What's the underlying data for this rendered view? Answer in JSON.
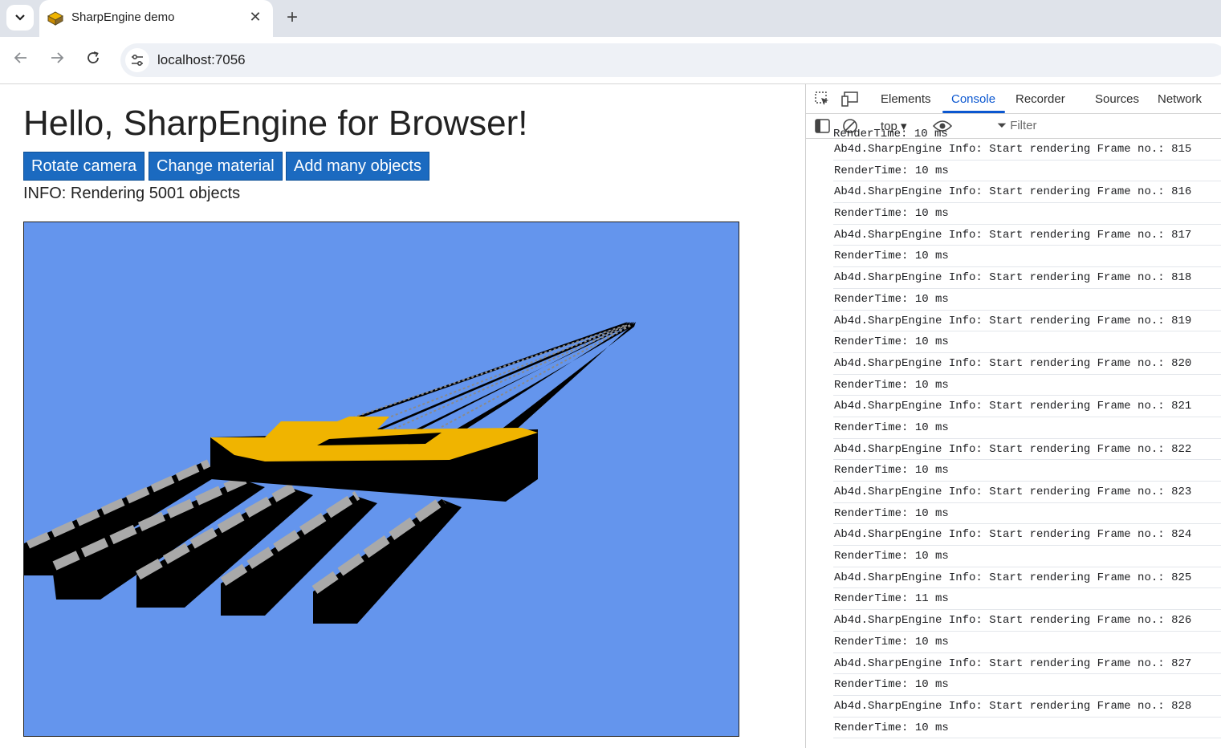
{
  "browser": {
    "tab_title": "SharpEngine demo",
    "url": "localhost:7056"
  },
  "page": {
    "heading": "Hello, SharpEngine for Browser!",
    "buttons": [
      "Rotate camera",
      "Change material",
      "Add many objects"
    ],
    "info": "INFO: Rendering 5001 objects",
    "colors": {
      "scene_background": "#6495ed",
      "button": "#1b6ac0",
      "highlight_objects": "#f0b400",
      "box_top": "#a9a9a9"
    }
  },
  "devtools": {
    "tabs": [
      "Elements",
      "Console",
      "Recorder",
      "Sources",
      "Network"
    ],
    "active_tab": "Console",
    "context": "top",
    "filter_placeholder": "Filter",
    "partial_line": "RenderTime: 10 ms",
    "log": [
      "Ab4d.SharpEngine Info: Start rendering Frame no.: 815",
      "RenderTime: 10 ms",
      "Ab4d.SharpEngine Info: Start rendering Frame no.: 816",
      "RenderTime: 10 ms",
      "Ab4d.SharpEngine Info: Start rendering Frame no.: 817",
      "RenderTime: 10 ms",
      "Ab4d.SharpEngine Info: Start rendering Frame no.: 818",
      "RenderTime: 10 ms",
      "Ab4d.SharpEngine Info: Start rendering Frame no.: 819",
      "RenderTime: 10 ms",
      "Ab4d.SharpEngine Info: Start rendering Frame no.: 820",
      "RenderTime: 10 ms",
      "Ab4d.SharpEngine Info: Start rendering Frame no.: 821",
      "RenderTime: 10 ms",
      "Ab4d.SharpEngine Info: Start rendering Frame no.: 822",
      "RenderTime: 10 ms",
      "Ab4d.SharpEngine Info: Start rendering Frame no.: 823",
      "RenderTime: 10 ms",
      "Ab4d.SharpEngine Info: Start rendering Frame no.: 824",
      "RenderTime: 10 ms",
      "Ab4d.SharpEngine Info: Start rendering Frame no.: 825",
      "RenderTime: 11 ms",
      "Ab4d.SharpEngine Info: Start rendering Frame no.: 826",
      "RenderTime: 10 ms",
      "Ab4d.SharpEngine Info: Start rendering Frame no.: 827",
      "RenderTime: 10 ms",
      "Ab4d.SharpEngine Info: Start rendering Frame no.: 828",
      "RenderTime: 10 ms"
    ]
  }
}
